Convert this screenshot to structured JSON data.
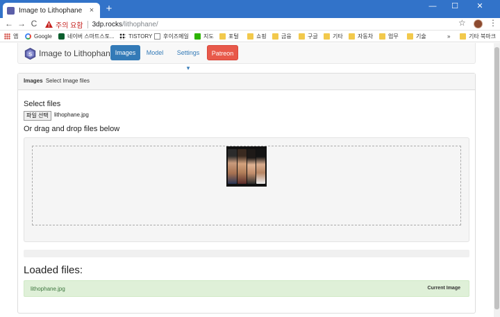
{
  "browser": {
    "tab_title": "Image to Lithophane",
    "tab_close": "×",
    "new_tab": "+",
    "window_controls": [
      "—",
      "☐",
      "✕"
    ],
    "nav": {
      "back": "←",
      "forward": "→",
      "reload": "C"
    },
    "security_warning": "주의 요함",
    "url_host": "3dp.rocks",
    "url_path": "/lithophane/",
    "star": "☆",
    "menu": "⋮",
    "bookmarks": [
      {
        "label": "앱",
        "icon": "apps-grid-icon"
      },
      {
        "label": "Google",
        "icon": "google-icon"
      },
      {
        "label": "네이버 스마트스토...",
        "icon": "smartstore-icon"
      },
      {
        "label": "TISTORY",
        "icon": "tistory-icon"
      },
      {
        "label": "후이즈메일",
        "icon": "page-icon"
      },
      {
        "label": "지도",
        "icon": "naver-map-icon"
      },
      {
        "label": "포털",
        "icon": "folder-icon"
      },
      {
        "label": "쇼핑",
        "icon": "folder-icon"
      },
      {
        "label": "금융",
        "icon": "folder-icon"
      },
      {
        "label": "구글",
        "icon": "folder-icon"
      },
      {
        "label": "기타",
        "icon": "folder-icon"
      },
      {
        "label": "자동차",
        "icon": "folder-icon"
      },
      {
        "label": "업무",
        "icon": "folder-icon"
      },
      {
        "label": "기술",
        "icon": "folder-icon"
      }
    ],
    "bookmarks_overflow": "»",
    "other_bookmarks": "기타 북마크"
  },
  "site": {
    "brand": "Image to Lithophane",
    "nav": {
      "images": "Images",
      "model": "Model",
      "settings": "Settings ▾",
      "patreon": "Patreon"
    }
  },
  "panel": {
    "heading_title": "Images",
    "heading_sub": "Select Image files",
    "select_files": "Select files",
    "file_button": "파일 선택",
    "file_name": "lithophane.jpg",
    "drag_drop": "Or drag and drop files below",
    "loaded_files": "Loaded files:",
    "loaded": [
      {
        "name": "lithophane.jpg",
        "badge": "Current Image"
      }
    ]
  },
  "colors": {
    "chrome_blue": "#3273c9",
    "primary": "#337ab7",
    "patreon": "#e8594a",
    "success_bg": "#dff0d8"
  }
}
